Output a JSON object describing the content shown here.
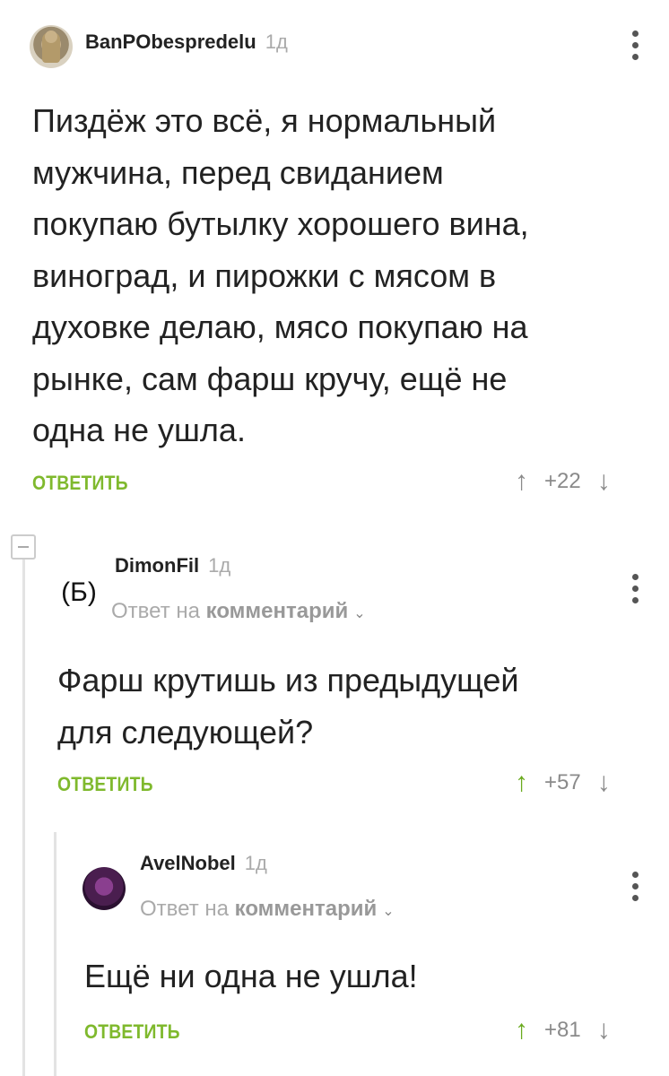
{
  "comments": [
    {
      "username": "BanPObespredelu",
      "time": "1д",
      "text_lines": [
        "Пиздёж это всё, я нормальный",
        "мужчина, перед свиданием",
        "покупаю бутылку хорошего вина,",
        "виноград, и пирожки с мясом в",
        "духовке делаю, мясо покупаю на",
        "рынке, сам фарш кручу, ещё не",
        "одна не ушла."
      ],
      "reply_label": "ОТВЕТИТЬ",
      "score": "+22"
    },
    {
      "username": "DimonFil",
      "time": "1д",
      "avatar_text": "(Б)",
      "reply_to_prefix": "Ответ на",
      "reply_to_target": "комментарий",
      "text_lines": [
        "Фарш крутишь из предыдущей",
        "для следующей?"
      ],
      "reply_label": "ОТВЕТИТЬ",
      "score": "+57"
    },
    {
      "username": "AvelNobel",
      "time": "1д",
      "reply_to_prefix": "Ответ на",
      "reply_to_target": "комментарий",
      "text_lines": [
        "Ещё ни одна не ушла!"
      ],
      "reply_label": "ОТВЕТИТЬ",
      "score": "+81"
    }
  ],
  "icons": {
    "up": "↑",
    "down": "↓",
    "chevron": "⌄"
  },
  "colors": {
    "accent_green": "#7fb92d",
    "upvoted_green": "#6aaa1e"
  }
}
